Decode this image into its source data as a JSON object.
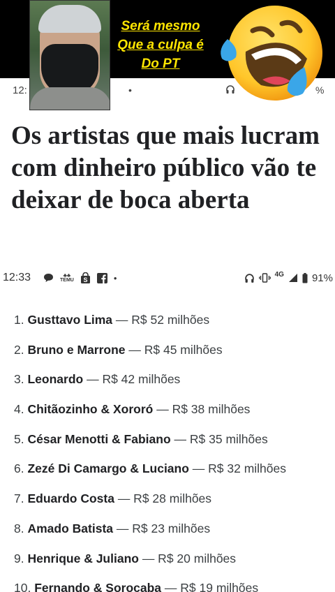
{
  "overlay": {
    "caption_lines": [
      "Será mesmo",
      "Que a culpa é",
      "Do PT"
    ],
    "caption_color": "#ffe600",
    "emoji": "rolling-on-floor-laughing"
  },
  "status_bar_top": {
    "time": "12:",
    "percent_fragment": "%"
  },
  "article": {
    "headline": "Os artistas que mais lucram com dinheiro público vão te deixar de boca aberta"
  },
  "status_bar": {
    "time": "12:33",
    "network": "4G",
    "battery": "91%",
    "temu_label": "TEMU"
  },
  "ranking": [
    {
      "num": "1.",
      "name": "Gusttavo Lima",
      "value": " — R$ 52 milhões"
    },
    {
      "num": "2.",
      "name": "Bruno e Marrone",
      "value": " — R$ 45 milhões"
    },
    {
      "num": "3.",
      "name": "Leonardo",
      "value": " — R$ 42 milhões"
    },
    {
      "num": "4.",
      "name": "Chitãozinho & Xororó",
      "value": " — R$ 38 milhões"
    },
    {
      "num": "5.",
      "name": "César Menotti & Fabiano",
      "value": " — R$ 35 milhões"
    },
    {
      "num": "6.",
      "name": "Zezé Di Camargo & Luciano",
      "value": " — R$ 32 milhões"
    },
    {
      "num": "7.",
      "name": "Eduardo Costa",
      "value": " — R$ 28 milhões"
    },
    {
      "num": "8.",
      "name": "Amado Batista",
      "value": " — R$ 23 milhões"
    },
    {
      "num": "9.",
      "name": "Henrique & Juliano",
      "value": " — R$ 20 milhões"
    },
    {
      "num": "10.",
      "name": "Fernando & Sorocaba",
      "value": " — R$ 19 milhões"
    }
  ]
}
